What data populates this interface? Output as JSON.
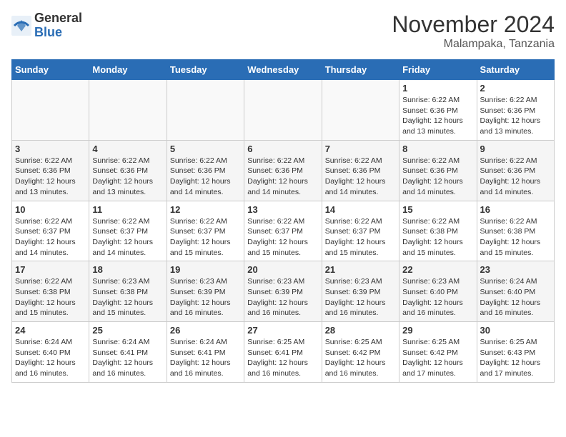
{
  "logo": {
    "general": "General",
    "blue": "Blue"
  },
  "header": {
    "month": "November 2024",
    "location": "Malampaka, Tanzania"
  },
  "weekdays": [
    "Sunday",
    "Monday",
    "Tuesday",
    "Wednesday",
    "Thursday",
    "Friday",
    "Saturday"
  ],
  "weeks": [
    [
      {
        "day": "",
        "info": ""
      },
      {
        "day": "",
        "info": ""
      },
      {
        "day": "",
        "info": ""
      },
      {
        "day": "",
        "info": ""
      },
      {
        "day": "",
        "info": ""
      },
      {
        "day": "1",
        "info": "Sunrise: 6:22 AM\nSunset: 6:36 PM\nDaylight: 12 hours\nand 13 minutes."
      },
      {
        "day": "2",
        "info": "Sunrise: 6:22 AM\nSunset: 6:36 PM\nDaylight: 12 hours\nand 13 minutes."
      }
    ],
    [
      {
        "day": "3",
        "info": "Sunrise: 6:22 AM\nSunset: 6:36 PM\nDaylight: 12 hours\nand 13 minutes."
      },
      {
        "day": "4",
        "info": "Sunrise: 6:22 AM\nSunset: 6:36 PM\nDaylight: 12 hours\nand 13 minutes."
      },
      {
        "day": "5",
        "info": "Sunrise: 6:22 AM\nSunset: 6:36 PM\nDaylight: 12 hours\nand 14 minutes."
      },
      {
        "day": "6",
        "info": "Sunrise: 6:22 AM\nSunset: 6:36 PM\nDaylight: 12 hours\nand 14 minutes."
      },
      {
        "day": "7",
        "info": "Sunrise: 6:22 AM\nSunset: 6:36 PM\nDaylight: 12 hours\nand 14 minutes."
      },
      {
        "day": "8",
        "info": "Sunrise: 6:22 AM\nSunset: 6:36 PM\nDaylight: 12 hours\nand 14 minutes."
      },
      {
        "day": "9",
        "info": "Sunrise: 6:22 AM\nSunset: 6:36 PM\nDaylight: 12 hours\nand 14 minutes."
      }
    ],
    [
      {
        "day": "10",
        "info": "Sunrise: 6:22 AM\nSunset: 6:37 PM\nDaylight: 12 hours\nand 14 minutes."
      },
      {
        "day": "11",
        "info": "Sunrise: 6:22 AM\nSunset: 6:37 PM\nDaylight: 12 hours\nand 14 minutes."
      },
      {
        "day": "12",
        "info": "Sunrise: 6:22 AM\nSunset: 6:37 PM\nDaylight: 12 hours\nand 15 minutes."
      },
      {
        "day": "13",
        "info": "Sunrise: 6:22 AM\nSunset: 6:37 PM\nDaylight: 12 hours\nand 15 minutes."
      },
      {
        "day": "14",
        "info": "Sunrise: 6:22 AM\nSunset: 6:37 PM\nDaylight: 12 hours\nand 15 minutes."
      },
      {
        "day": "15",
        "info": "Sunrise: 6:22 AM\nSunset: 6:38 PM\nDaylight: 12 hours\nand 15 minutes."
      },
      {
        "day": "16",
        "info": "Sunrise: 6:22 AM\nSunset: 6:38 PM\nDaylight: 12 hours\nand 15 minutes."
      }
    ],
    [
      {
        "day": "17",
        "info": "Sunrise: 6:22 AM\nSunset: 6:38 PM\nDaylight: 12 hours\nand 15 minutes."
      },
      {
        "day": "18",
        "info": "Sunrise: 6:23 AM\nSunset: 6:38 PM\nDaylight: 12 hours\nand 15 minutes."
      },
      {
        "day": "19",
        "info": "Sunrise: 6:23 AM\nSunset: 6:39 PM\nDaylight: 12 hours\nand 16 minutes."
      },
      {
        "day": "20",
        "info": "Sunrise: 6:23 AM\nSunset: 6:39 PM\nDaylight: 12 hours\nand 16 minutes."
      },
      {
        "day": "21",
        "info": "Sunrise: 6:23 AM\nSunset: 6:39 PM\nDaylight: 12 hours\nand 16 minutes."
      },
      {
        "day": "22",
        "info": "Sunrise: 6:23 AM\nSunset: 6:40 PM\nDaylight: 12 hours\nand 16 minutes."
      },
      {
        "day": "23",
        "info": "Sunrise: 6:24 AM\nSunset: 6:40 PM\nDaylight: 12 hours\nand 16 minutes."
      }
    ],
    [
      {
        "day": "24",
        "info": "Sunrise: 6:24 AM\nSunset: 6:40 PM\nDaylight: 12 hours\nand 16 minutes."
      },
      {
        "day": "25",
        "info": "Sunrise: 6:24 AM\nSunset: 6:41 PM\nDaylight: 12 hours\nand 16 minutes."
      },
      {
        "day": "26",
        "info": "Sunrise: 6:24 AM\nSunset: 6:41 PM\nDaylight: 12 hours\nand 16 minutes."
      },
      {
        "day": "27",
        "info": "Sunrise: 6:25 AM\nSunset: 6:41 PM\nDaylight: 12 hours\nand 16 minutes."
      },
      {
        "day": "28",
        "info": "Sunrise: 6:25 AM\nSunset: 6:42 PM\nDaylight: 12 hours\nand 16 minutes."
      },
      {
        "day": "29",
        "info": "Sunrise: 6:25 AM\nSunset: 6:42 PM\nDaylight: 12 hours\nand 17 minutes."
      },
      {
        "day": "30",
        "info": "Sunrise: 6:25 AM\nSunset: 6:43 PM\nDaylight: 12 hours\nand 17 minutes."
      }
    ]
  ]
}
